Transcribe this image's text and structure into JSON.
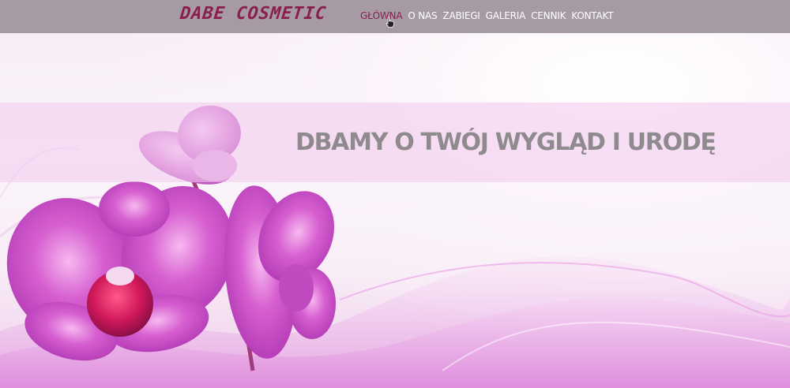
{
  "brand": {
    "logo_text": "DABE COSMETIC",
    "color": "#8a1f4e"
  },
  "nav": {
    "items": [
      {
        "label": "GŁÓWNA",
        "active": true
      },
      {
        "label": "O NAS"
      },
      {
        "label": "ZABIEGI"
      },
      {
        "label": "GALERIA"
      },
      {
        "label": "CENNIK"
      },
      {
        "label": "KONTAKT"
      }
    ],
    "bar_color": "#a69ba4"
  },
  "hero": {
    "headline": "DBAMY O TWÓJ WYGLĄD I URODĘ",
    "image": "pink-orchid-with-silk-waves"
  }
}
